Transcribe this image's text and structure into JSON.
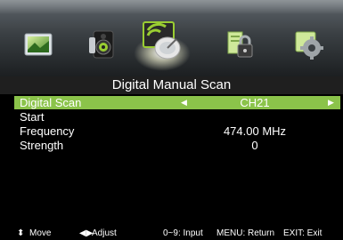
{
  "menu": {
    "icons": [
      {
        "name": "picture-icon"
      },
      {
        "name": "sound-icon"
      },
      {
        "name": "channel-icon",
        "selected": true
      },
      {
        "name": "lock-icon"
      },
      {
        "name": "setup-icon"
      }
    ]
  },
  "title": "Digital Manual Scan",
  "rows": [
    {
      "label": "Digital Scan",
      "value": "CH21"
    },
    {
      "label": "Start",
      "value": ""
    },
    {
      "label": "Frequency",
      "value": "474.00 MHz"
    },
    {
      "label": "Strength",
      "value": "0"
    }
  ],
  "footer": {
    "move": "Move",
    "adjust": "Adjust",
    "input": "0~9: Input",
    "menu": "MENU: Return",
    "exit": "EXIT: Exit"
  },
  "colors": {
    "highlight": "#8bc34a",
    "title_bar": "#1f1f1f"
  }
}
